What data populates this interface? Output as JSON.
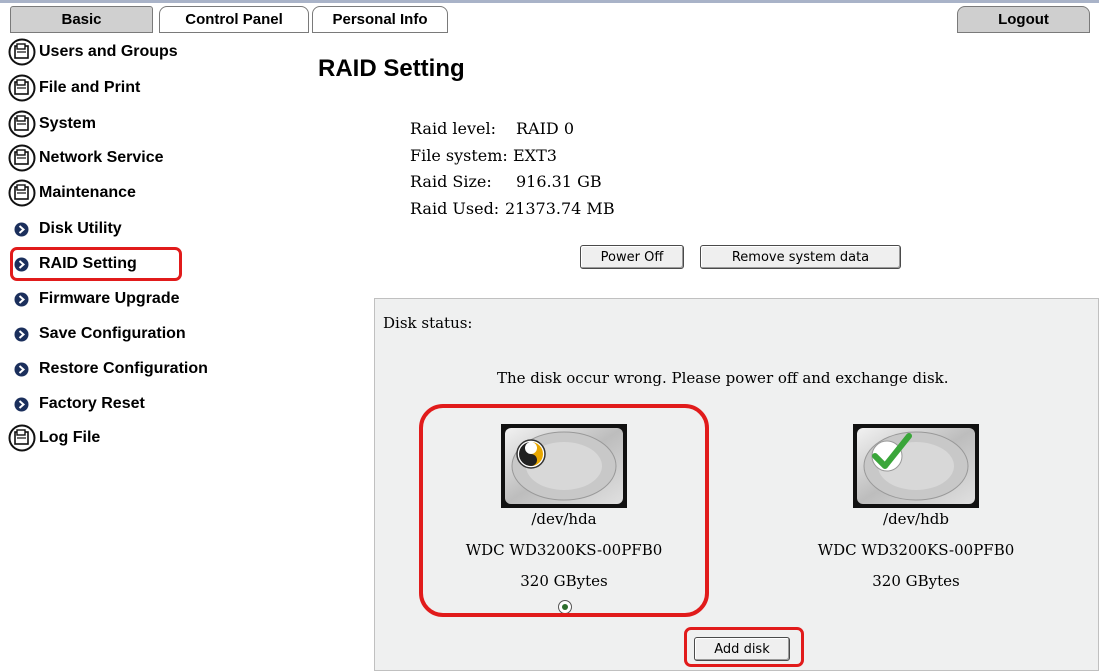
{
  "tabs": {
    "basic": "Basic",
    "control_panel": "Control Panel",
    "personal_info": "Personal Info",
    "logout": "Logout"
  },
  "sidebar": {
    "items": [
      {
        "label": "Users and Groups",
        "icon": "folder-icon"
      },
      {
        "label": "File and Print",
        "icon": "folder-icon"
      },
      {
        "label": "System",
        "icon": "folder-icon"
      },
      {
        "label": "Network Service",
        "icon": "folder-icon"
      },
      {
        "label": "Maintenance",
        "icon": "folder-icon"
      },
      {
        "label": "Disk Utility",
        "icon": "bullet-icon"
      },
      {
        "label": "RAID Setting",
        "icon": "bullet-icon"
      },
      {
        "label": "Firmware Upgrade",
        "icon": "bullet-icon"
      },
      {
        "label": "Save Configuration",
        "icon": "bullet-icon"
      },
      {
        "label": "Restore Configuration",
        "icon": "bullet-icon"
      },
      {
        "label": "Factory Reset",
        "icon": "bullet-icon"
      },
      {
        "label": "Log File",
        "icon": "folder-icon"
      }
    ]
  },
  "main": {
    "title": "RAID Setting",
    "info": {
      "raid_level_label": "Raid level:",
      "raid_level": "RAID 0",
      "file_system_label": "File system:",
      "file_system": "EXT3",
      "raid_size_label": "Raid Size:",
      "raid_size": "916.31 GB",
      "raid_used_label": "Raid Used:",
      "raid_used": "21373.74 MB"
    },
    "buttons": {
      "power_off": "Power Off",
      "remove_system_data": "Remove system data",
      "add_disk": "Add disk"
    },
    "disk_status": {
      "label": "Disk status:",
      "message": "The disk occur wrong. Please power off and exchange disk.",
      "disks": [
        {
          "device": "/dev/hda",
          "model": "WDC WD3200KS-00PFB0",
          "capacity": "320 GBytes",
          "status": "warning",
          "selected": true
        },
        {
          "device": "/dev/hdb",
          "model": "WDC WD3200KS-00PFB0",
          "capacity": "320 GBytes",
          "status": "ok"
        }
      ]
    }
  },
  "colors": {
    "highlight": "#e11b1b",
    "panel_bg": "#eff0f0",
    "tab_bg": "#d0d0d0"
  }
}
